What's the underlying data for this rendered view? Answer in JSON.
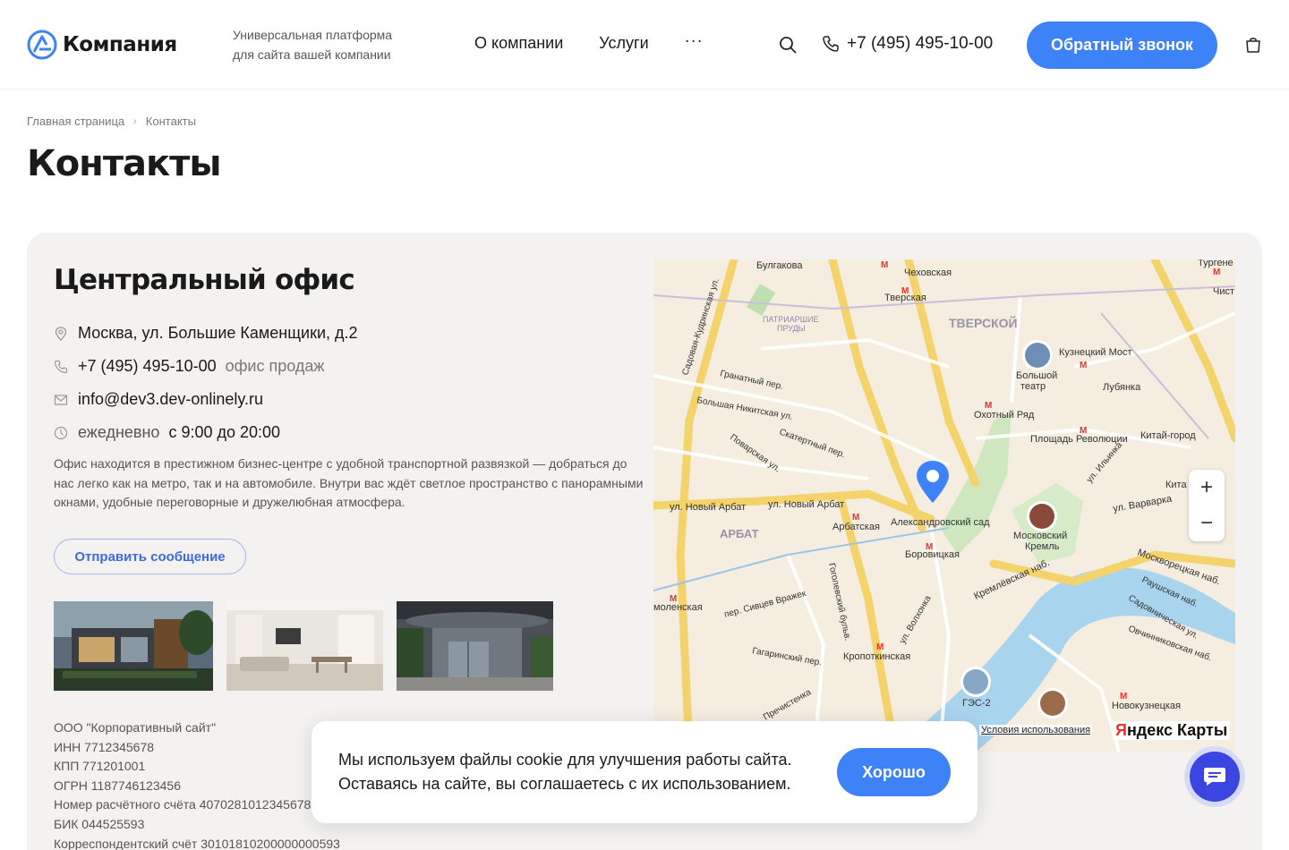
{
  "header": {
    "logo_text": "Компания",
    "tagline_line1": "Универсальная платформа",
    "tagline_line2": "для сайта вашей компании",
    "nav": [
      "О компании",
      "Услуги"
    ],
    "nav_more": "···",
    "phone": "+7 (495) 495-10-00",
    "callback_label": "Обратный звонок"
  },
  "breadcrumb": {
    "home": "Главная страница",
    "separator": "›",
    "current": "Контакты"
  },
  "page_title": "Контакты",
  "office": {
    "title": "Центральный офис",
    "address": "Москва, ул. Большие Каменщики, д.2",
    "phone": "+7 (495) 495-10-00",
    "phone_note": "офис продаж",
    "email": "info@dev3.dev-onlinely.ru",
    "hours_label": "ежедневно",
    "hours_value": "с 9:00 до 20:00",
    "description": "Офис находится в престижном бизнес-центре с удобной транспортной развязкой — добраться до нас легко как на метро, так и на автомобиле. Внутри вас ждёт светлое пространство с панорамными окнами, удобные переговорные и дружелюбная атмосфера.",
    "send_button": "Отправить сообщение",
    "legal": {
      "company": "ООО \"Корпоративный сайт\"",
      "inn": "ИНН 7712345678",
      "kpp": "КПП 771201001",
      "ogrn": "ОГРН 1187746123456",
      "account": "Номер расчётного счёта 40702810123456789012",
      "bik": "БИК 044525593",
      "corr": "Корреспондентский счёт 30101810200000000593"
    }
  },
  "map": {
    "labels": {
      "bulgakova": "Булгакова",
      "chekhovskaya": "Чеховская",
      "turgenevskaya": "Тургене",
      "chist": "Чист",
      "tverskaya": "Тверская",
      "tverskoy": "ТВЕРСКОЙ",
      "patriarshie": "ПАТРИАРШИЕ",
      "prudy": "ПРУДЫ",
      "kuznetsky": "Кузнецкий Мост",
      "bolshoi1": "Большой",
      "bolshoi2": "театр",
      "lubyanka": "Лубянка",
      "okhotny": "Охотный Ряд",
      "revolution": "Площадь Революции",
      "kitay": "Китай-город",
      "kita": "Кита",
      "arbat_st1": "ул. Новый Арбат",
      "arbat_st2": "ул. Новый Арбат",
      "arbatskaya": "Арбатская",
      "arbat_district": "АРБАТ",
      "alexander_garden": "Александровский сад",
      "borovitskaya": "Боровицкая",
      "kremlin1": "Московский",
      "kremlin2": "Кремль",
      "varvarka": "ул. Варварка",
      "moskvoretskaya": "Москворецкая наб.",
      "kremlevskaya": "Кремлёвская наб.",
      "kropotkinskaya": "Кропоткинская",
      "smolenskaya": "моленская",
      "ges": "ГЭС-2",
      "novokuznetskaya": "Новокузнецкая",
      "sadovaya": "Садовая-Кудринская ул.",
      "bolshaya_nikitskaya": "Большая Никитская ул.",
      "granatny": "Гранатный пер.",
      "povarskaya": "Поварская ул.",
      "skatertny": "Скатертный пер.",
      "volkhonka": "ул. Волхонка",
      "prechistenka": "Пречистенка",
      "gagarinsky": "Гагаринский пер.",
      "sivtsev": "пер. Сивцев Вражек",
      "gogolevsky": "Гоголевский бульв.",
      "raushskaya": "Раушская наб.",
      "sadovnicheskaya": "Садовническая ул.",
      "ovchinnikovskaya": "Овчинниковская наб.",
      "ilyinka": "ул. Ильинка"
    },
    "terms": "Условия использования",
    "brand_y": "Я",
    "brand_rest": "ндекс Карты",
    "zoom_in": "+",
    "zoom_out": "−"
  },
  "cookie": {
    "line1": "Мы используем файлы cookie для улучшения работы сайта.",
    "line2": "Оставаясь на сайте, вы соглашаетесь с их использованием.",
    "button": "Хорошо"
  },
  "colors": {
    "accent": "#3e82f7",
    "card_bg": "#f3f2f0",
    "chat": "#3b46e0"
  }
}
